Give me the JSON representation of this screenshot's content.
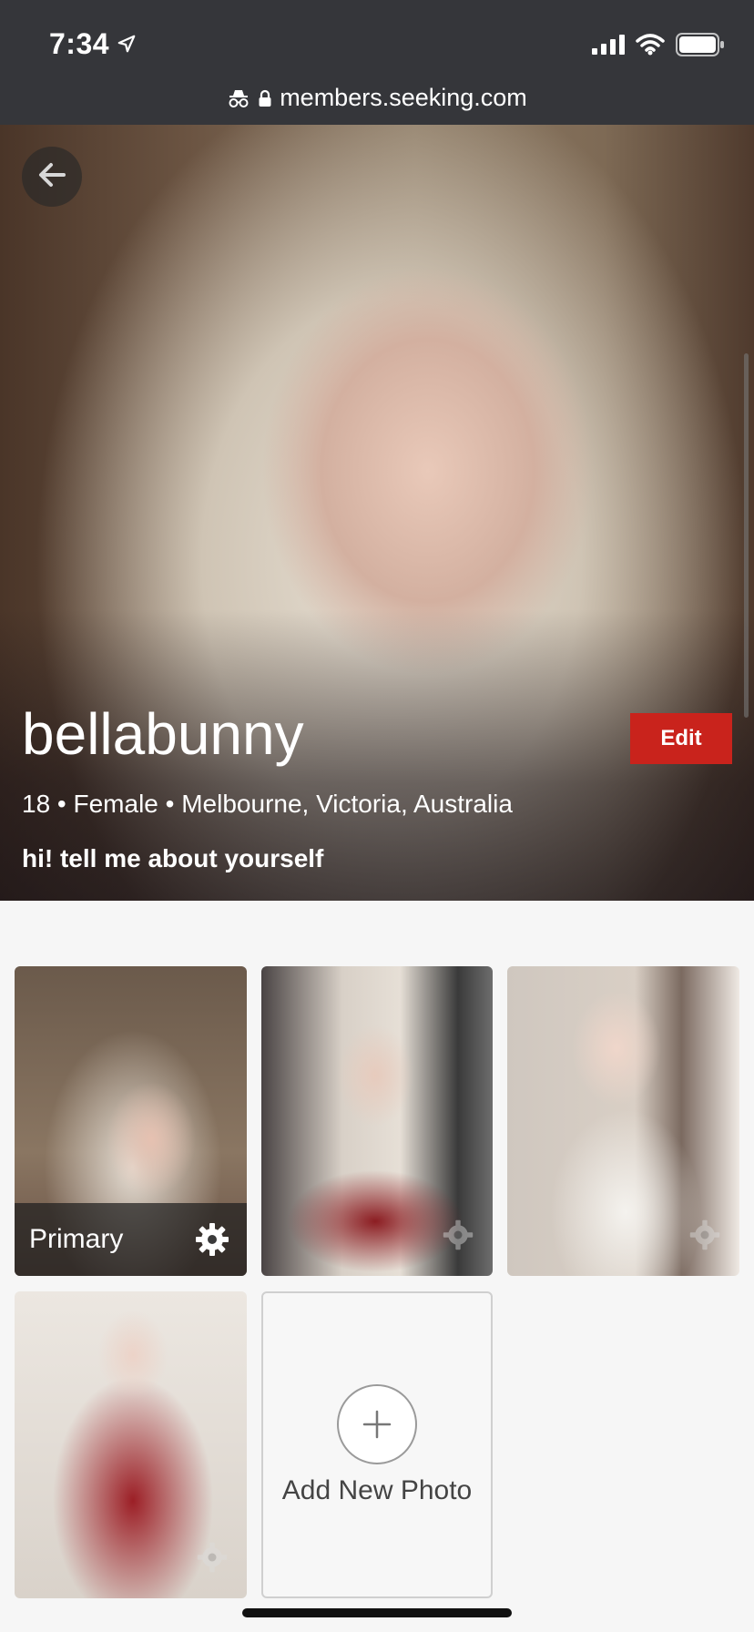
{
  "status_bar": {
    "time": "7:34",
    "location_icon": "location-arrow-icon",
    "icons": [
      "signal-icon",
      "wifi-icon",
      "battery-icon"
    ]
  },
  "browser": {
    "url": "members.seeking.com",
    "icons": [
      "incognito-icon",
      "lock-icon"
    ]
  },
  "profile": {
    "username": "bellabunny",
    "details": "18 • Female • Melbourne, Victoria, Australia",
    "bio": "hi! tell me about yourself",
    "edit_label": "Edit"
  },
  "photos": {
    "primary_label": "Primary",
    "add_label": "Add New Photo",
    "count": 4
  },
  "colors": {
    "chrome_bg": "#35363a",
    "edit_button": "#c9231c",
    "page_bg": "#f6f6f6"
  }
}
